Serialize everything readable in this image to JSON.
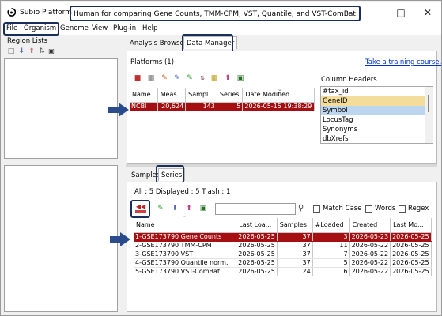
{
  "window": {
    "app_title": "Subio Platform",
    "document_title": "Human for comparing Gene Counts, TMM-CPM, VST, Quantile, and VST-ComBat"
  },
  "menu": [
    "File",
    "Organism",
    "Genome",
    "View",
    "Plug-in",
    "Help"
  ],
  "left_panel": {
    "title": "Region Lists"
  },
  "top_tabs": [
    "Analysis Browser",
    "Data Manager"
  ],
  "platforms": {
    "title": "Platforms (1)",
    "training_link": "Take a training course.",
    "columns": [
      "Name",
      "Meas...",
      "Sampl...",
      "Series",
      "Date Modified"
    ],
    "rows": [
      {
        "name": "NCBI",
        "meas": "20,624",
        "samples": "143",
        "series": "5",
        "date": "2026-05-15 19:38:29",
        "selected": true
      }
    ]
  },
  "column_headers": {
    "title": "Column Headers",
    "items": [
      {
        "label": "#tax_id",
        "state": "normal"
      },
      {
        "label": "GeneID",
        "state": "yellow"
      },
      {
        "label": "Symbol",
        "state": "blue"
      },
      {
        "label": "LocusTag",
        "state": "normal"
      },
      {
        "label": "Synonyms",
        "state": "normal"
      },
      {
        "label": "dbXrefs",
        "state": "normal"
      }
    ]
  },
  "bottom_tabs": [
    "Samples",
    "Series"
  ],
  "series": {
    "counts": "All : 5  Displayed : 5  Trash : 1",
    "search": {
      "value": "",
      "placeholder": ""
    },
    "match_case": "Match Case",
    "words": "Words",
    "regex": "Regex",
    "columns": [
      "Name",
      "Last Loa...",
      "Samples",
      "#Loaded",
      "Created",
      "Last Mo..."
    ],
    "rows": [
      {
        "name": "1-GSE173790 Gene Counts",
        "last_loaded": "2026-05-25",
        "samples": "37",
        "loaded": "3",
        "created": "2026-05-23",
        "last_modified": "2026-05-25",
        "selected": true
      },
      {
        "name": "2-GSE173790 TMM-CPM",
        "last_loaded": "2026-05-25",
        "samples": "37",
        "loaded": "11",
        "created": "2026-05-22",
        "last_modified": "2026-05-25",
        "selected": false
      },
      {
        "name": "3-GSE173790 VST",
        "last_loaded": "2026-05-25",
        "samples": "37",
        "loaded": "7",
        "created": "2026-05-22",
        "last_modified": "2026-05-25",
        "selected": false
      },
      {
        "name": "4-GSE173790 Quantile norm.",
        "last_loaded": "2026-05-25",
        "samples": "37",
        "loaded": "5",
        "created": "2026-05-22",
        "last_modified": "2026-05-25",
        "selected": false
      },
      {
        "name": "5-GSE173790 VST-ComBat",
        "last_loaded": "2026-05-25",
        "samples": "24",
        "loaded": "6",
        "created": "2026-05-22",
        "last_modified": "2026-05-25",
        "selected": false
      }
    ]
  },
  "colors": {
    "selection": "#a50f12",
    "annotation_box": "#1a2e5c",
    "annotation_arrow": "#2b4c8c",
    "link": "#0033cc"
  }
}
